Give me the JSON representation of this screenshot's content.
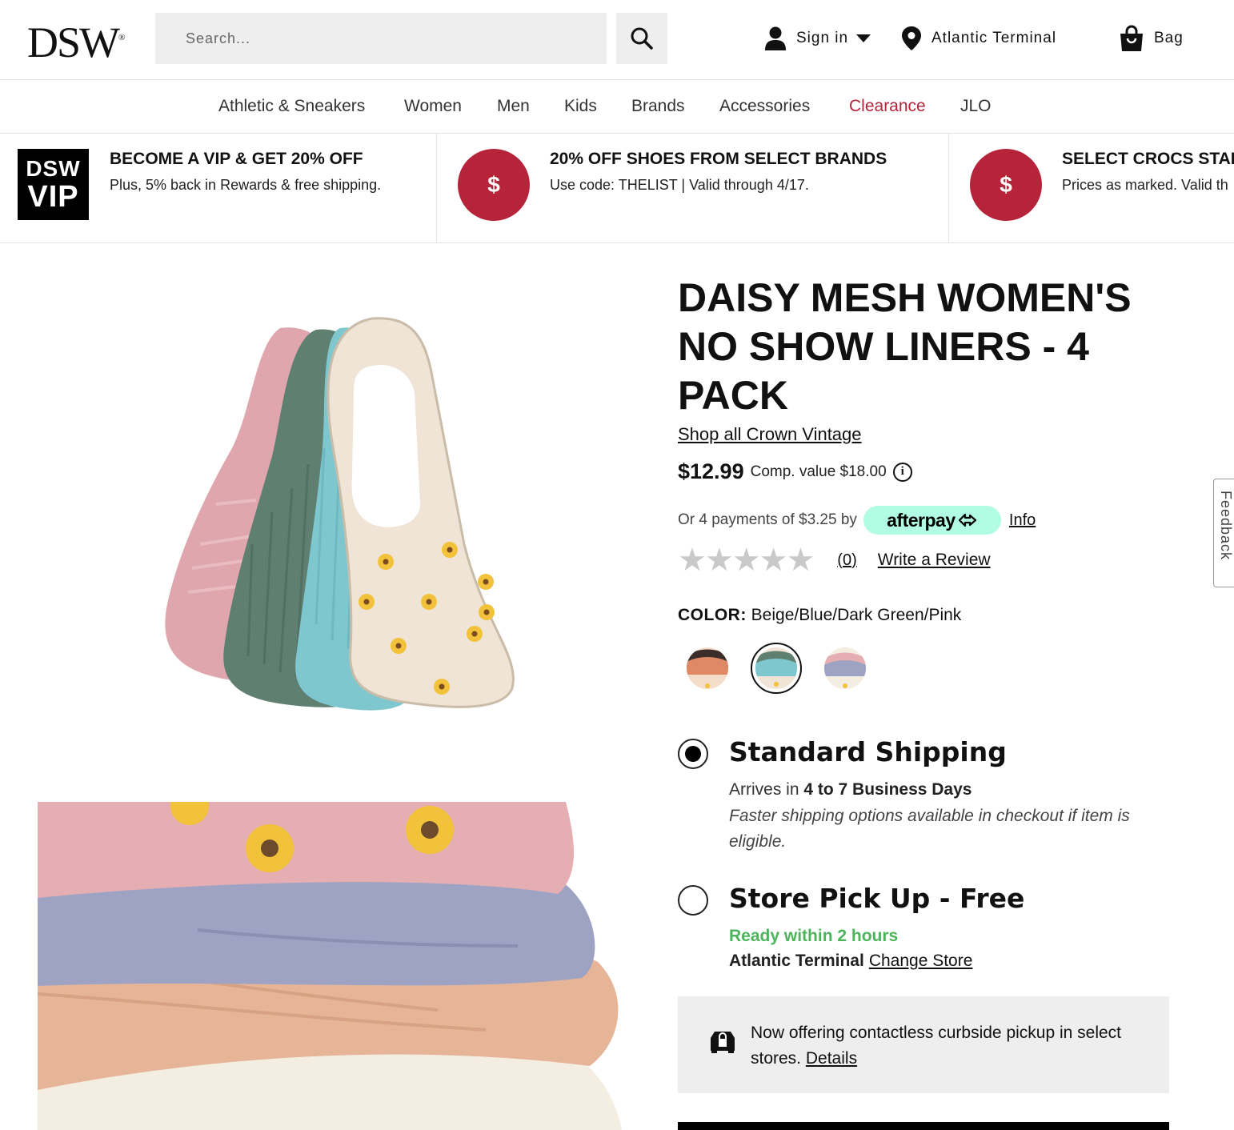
{
  "header": {
    "logo": "DSW",
    "logo_mark": "®",
    "search_placeholder": "Search...",
    "sign_in": "Sign in",
    "store": "Atlantic Terminal",
    "bag": "Bag"
  },
  "nav": {
    "items": [
      "Athletic & Sneakers",
      "Women",
      "Men",
      "Kids",
      "Brands",
      "Accessories",
      "Clearance",
      "JLO"
    ]
  },
  "promos": [
    {
      "badge_top": "DSW",
      "badge_bottom": "VIP",
      "title": "BECOME A VIP & GET 20% OFF",
      "sub": "Plus, 5% back in Rewards & free shipping."
    },
    {
      "icon": "$",
      "title": "20% OFF SHOES FROM SELECT BRANDS",
      "sub": "Use code: THELIST | Valid through 4/17."
    },
    {
      "icon": "$",
      "title": "SELECT CROCS STAR",
      "sub": "Prices as marked. Valid th"
    }
  ],
  "product": {
    "title": "DAISY MESH WOMEN'S NO SHOW LINERS - 4 PACK",
    "brand_link": "Shop all Crown Vintage",
    "price": "$12.99",
    "comp_value": "Comp. value $18.00",
    "afterpay_text": "Or 4 payments of $3.25 by",
    "afterpay_brand": "afterpay",
    "afterpay_info": "Info",
    "rating_stars": "★★★★★",
    "rating_value": 0,
    "review_count": "(0)",
    "write_review": "Write a Review",
    "color_label": "COLOR:",
    "color_value": "Beige/Blue/Dark Green/Pink",
    "swatches": [
      "orange-multi",
      "beige-blue-multi",
      "pink-multi"
    ]
  },
  "shipping": {
    "standard_title": "Standard Shipping",
    "arrives_prefix": "Arrives in",
    "arrives_days": "4 to 7 Business Days",
    "faster_note": "Faster shipping options available in checkout if item is eligible.",
    "pickup_title": "Store Pick Up - Free",
    "ready": "Ready within 2 hours",
    "store": "Atlantic Terminal",
    "change_store": "Change Store"
  },
  "curbside": {
    "text": "Now offering contactless curbside pickup in select stores.",
    "details": "Details"
  },
  "feedback": "Feedback",
  "colors": {
    "brand_red": "#b5243a",
    "green": "#4cb45a",
    "afterpay_mint": "#b2fce4"
  }
}
